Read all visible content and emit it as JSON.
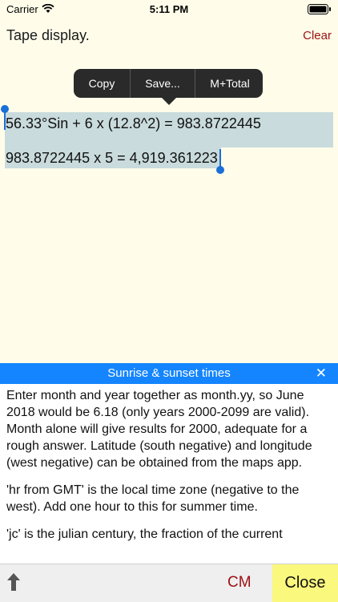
{
  "status_bar": {
    "carrier": "Carrier",
    "time": "5:11 PM"
  },
  "tape": {
    "title": "Tape display.",
    "clear_label": "Clear",
    "lines": [
      "56.33°Sin + 6 x (12.8^2) = 983.8722445",
      "983.8722445 x 5 = 4,919.361223"
    ]
  },
  "context_menu": {
    "items": [
      "Copy",
      "Save...",
      "M+Total"
    ]
  },
  "help": {
    "title": "Sunrise & sunset times",
    "paragraphs": [
      "Enter month and year together as month.yy, so June 2018 would be 6.18 (only years 2000-2099 are valid).  Month alone will give results for 2000, adequate for a rough answer.  Latitude (south negative) and longitude (west negative) can be obtained from the maps app.",
      "'hr from GMT' is the local time zone (negative to the west).  Add one hour to this for summer time.",
      "'jc' is the julian century, the fraction of the current"
    ]
  },
  "bottom_bar": {
    "cm_label": "CM",
    "close_label": "Close"
  },
  "colors": {
    "accent": "#1485ff",
    "clear_red": "#9c1111",
    "close_yellow": "#fbf87e",
    "tape_bg": "#fffdea"
  }
}
